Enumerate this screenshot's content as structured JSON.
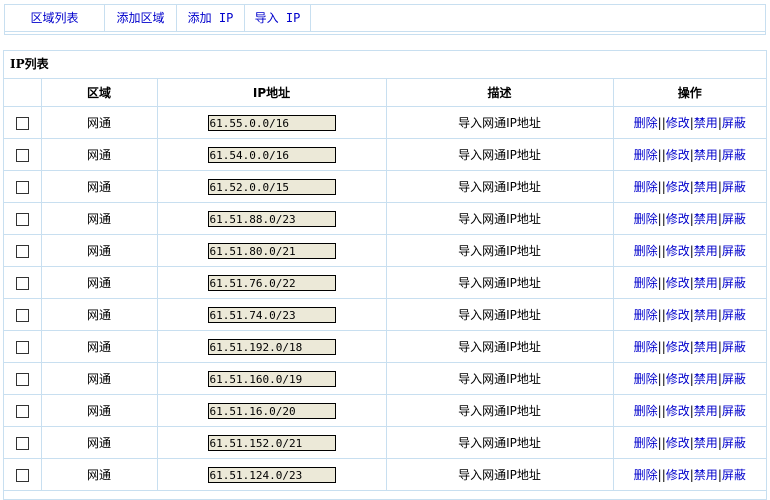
{
  "tabs": [
    {
      "label": "区域列表",
      "mono": false
    },
    {
      "label": "添加区域",
      "mono": false
    },
    {
      "label": "添加 IP",
      "mono": true
    },
    {
      "label": "导入 IP",
      "mono": true
    }
  ],
  "panel": {
    "title": "IP列表",
    "columns": [
      "区域",
      "IP地址",
      "描述",
      "操作"
    ],
    "actions": {
      "delete": "删除",
      "edit": "修改",
      "disable": "禁用",
      "block": "屏蔽"
    },
    "rows": [
      {
        "region": "网通",
        "ip": "61.55.0.0/16",
        "desc": "导入网通IP地址"
      },
      {
        "region": "网通",
        "ip": "61.54.0.0/16",
        "desc": "导入网通IP地址"
      },
      {
        "region": "网通",
        "ip": "61.52.0.0/15",
        "desc": "导入网通IP地址"
      },
      {
        "region": "网通",
        "ip": "61.51.88.0/23",
        "desc": "导入网通IP地址"
      },
      {
        "region": "网通",
        "ip": "61.51.80.0/21",
        "desc": "导入网通IP地址"
      },
      {
        "region": "网通",
        "ip": "61.51.76.0/22",
        "desc": "导入网通IP地址"
      },
      {
        "region": "网通",
        "ip": "61.51.74.0/23",
        "desc": "导入网通IP地址"
      },
      {
        "region": "网通",
        "ip": "61.51.192.0/18",
        "desc": "导入网通IP地址"
      },
      {
        "region": "网通",
        "ip": "61.51.160.0/19",
        "desc": "导入网通IP地址"
      },
      {
        "region": "网通",
        "ip": "61.51.16.0/20",
        "desc": "导入网通IP地址"
      },
      {
        "region": "网通",
        "ip": "61.51.152.0/21",
        "desc": "导入网通IP地址"
      },
      {
        "region": "网通",
        "ip": "61.51.124.0/23",
        "desc": "导入网通IP地址"
      }
    ]
  }
}
